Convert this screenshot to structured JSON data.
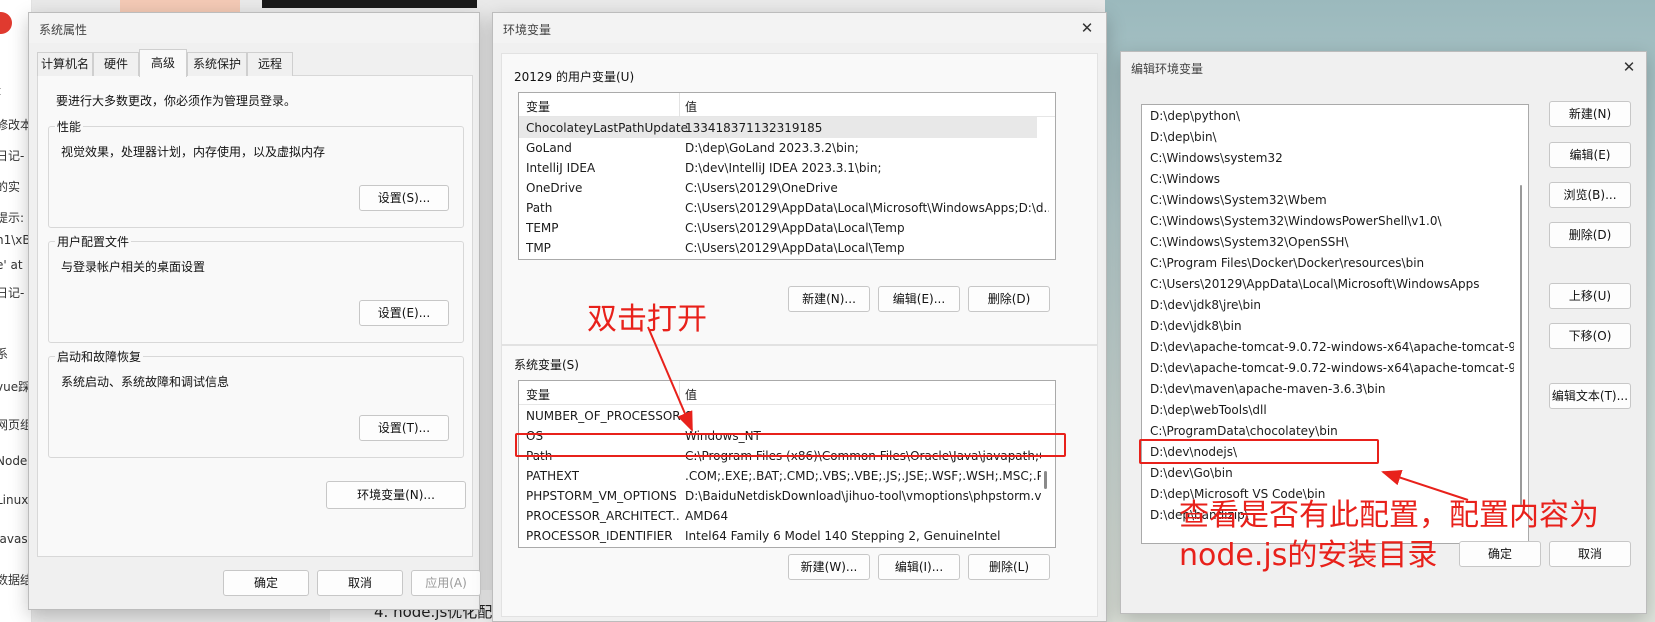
{
  "background": {
    "left_fragments": [
      "t",
      "修改本",
      "日记-",
      "的实",
      "提示:",
      "n1\\xBl",
      "e' at",
      "日记-",
      "系",
      "vue踩",
      "网页组",
      "Node",
      "Linux",
      "Javas",
      "数据结"
    ],
    "doc_text": "4. node.js优化配"
  },
  "sys_props": {
    "title": "系统属性",
    "close_label": "✕",
    "tabs": [
      "计算机名",
      "硬件",
      "高级",
      "系统保护",
      "远程"
    ],
    "notice": "要进行大多数更改，你必须作为管理员登录。",
    "performance": {
      "title": "性能",
      "desc": "视觉效果，处理器计划，内存使用，以及虚拟内存",
      "button": "设置(S)..."
    },
    "user_profile": {
      "title": "用户配置文件",
      "desc": "与登录帐户相关的桌面设置",
      "button": "设置(E)..."
    },
    "startup": {
      "title": "启动和故障恢复",
      "desc": "系统启动、系统故障和调试信息",
      "button": "设置(T)..."
    },
    "env_button": "环境变量(N)...",
    "ok": "确定",
    "cancel": "取消",
    "apply": "应用(A)"
  },
  "env_vars": {
    "title": "环境变量",
    "close_label": "✕",
    "user_section": "20129 的用户变量(U)",
    "col_name": "变量",
    "col_value": "值",
    "user_rows": [
      {
        "name": "ChocolateyLastPathUpdate",
        "value": "133418371132319185"
      },
      {
        "name": "GoLand",
        "value": "D:\\dep\\GoLand 2023.3.2\\bin;"
      },
      {
        "name": "IntelliJ IDEA",
        "value": "D:\\dev\\IntelliJ IDEA 2023.3.1\\bin;"
      },
      {
        "name": "OneDrive",
        "value": "C:\\Users\\20129\\OneDrive"
      },
      {
        "name": "Path",
        "value": "C:\\Users\\20129\\AppData\\Local\\Microsoft\\WindowsApps;D:\\d..."
      },
      {
        "name": "TEMP",
        "value": "C:\\Users\\20129\\AppData\\Local\\Temp"
      },
      {
        "name": "TMP",
        "value": "C:\\Users\\20129\\AppData\\Local\\Temp"
      }
    ],
    "user_buttons": [
      "新建(N)...",
      "编辑(E)...",
      "删除(D)"
    ],
    "system_section": "系统变量(S)",
    "system_rows": [
      {
        "name": "NUMBER_OF_PROCESSORS",
        "value": "8"
      },
      {
        "name": "OS",
        "value": "Windows_NT"
      },
      {
        "name": "Path",
        "value": "C:\\Program Files (x86)\\Common Files\\Oracle\\Java\\javapath;C:..."
      },
      {
        "name": "PATHEXT",
        "value": ".COM;.EXE;.BAT;.CMD;.VBS;.VBE;.JS;.JSE;.WSF;.WSH;.MSC;.PY;.P..."
      },
      {
        "name": "PHPSTORM_VM_OPTIONS",
        "value": "D:\\BaiduNetdiskDownload\\jihuo-tool\\vmoptions\\phpstorm.v..."
      },
      {
        "name": "PROCESSOR_ARCHITECT...",
        "value": "AMD64"
      },
      {
        "name": "PROCESSOR_IDENTIFIER",
        "value": "Intel64 Family 6 Model 140 Stepping 2, GenuineIntel"
      }
    ],
    "system_buttons": [
      "新建(W)...",
      "编辑(I)...",
      "删除(L)"
    ]
  },
  "edit_env": {
    "title": "编辑环境变量",
    "close_label": "✕",
    "paths": [
      "D:\\dep\\python\\",
      "D:\\dep\\bin\\",
      "C:\\Windows\\system32",
      "C:\\Windows",
      "C:\\Windows\\System32\\Wbem",
      "C:\\Windows\\System32\\WindowsPowerShell\\v1.0\\",
      "C:\\Windows\\System32\\OpenSSH\\",
      "C:\\Program Files\\Docker\\Docker\\resources\\bin",
      "C:\\Users\\20129\\AppData\\Local\\Microsoft\\WindowsApps",
      "D:\\dev\\jdk8\\jre\\bin",
      "D:\\dev\\jdk8\\bin",
      "D:\\dev\\apache-tomcat-9.0.72-windows-x64\\apache-tomcat-9...",
      "D:\\dev\\apache-tomcat-9.0.72-windows-x64\\apache-tomcat-9...",
      "D:\\dev\\maven\\apache-maven-3.6.3\\bin",
      "D:\\dep\\webTools\\dll",
      "C:\\ProgramData\\chocolatey\\bin",
      "D:\\dev\\nodejs\\",
      "D:\\dev\\Go\\bin",
      "D:\\dep\\Microsoft VS Code\\bin",
      "D:\\dep\\bandizip\\"
    ],
    "buttons": [
      "新建(N)",
      "编辑(E)",
      "浏览(B)...",
      "删除(D)",
      "上移(U)",
      "下移(O)",
      "编辑文本(T)..."
    ],
    "ok": "确定",
    "cancel": "取消"
  },
  "annotations": {
    "double_click": "双击打开",
    "check_config_line1": "查看是否有此配置，配置内容为",
    "check_config_line2": "node.js的安装目录",
    "color": "#e8211b"
  }
}
